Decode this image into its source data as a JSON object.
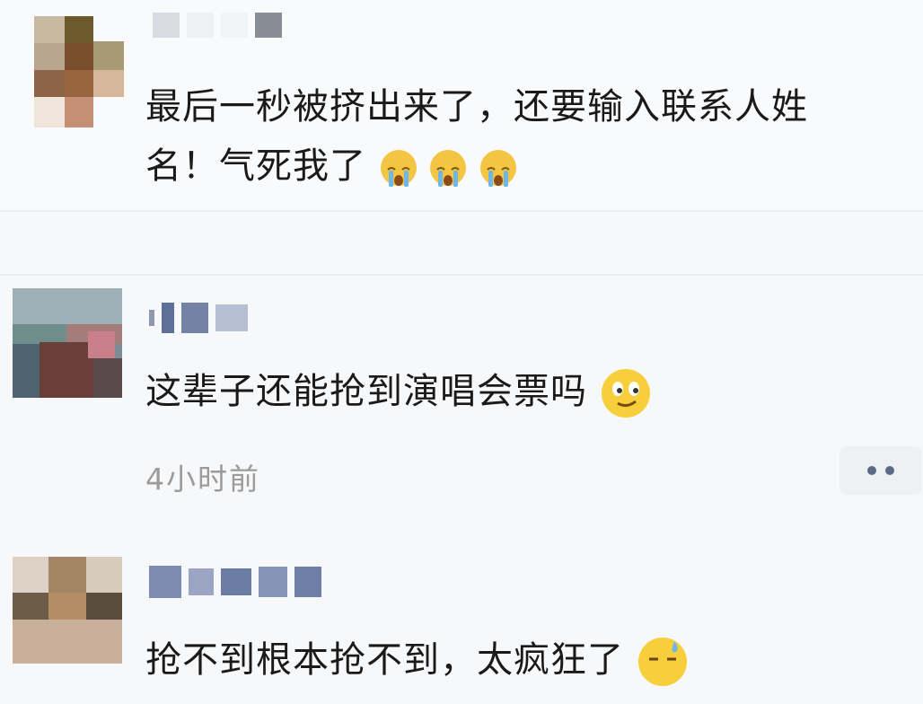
{
  "comments": [
    {
      "text_line1": "最后一秒被挤出来了，还要输入联系人姓",
      "text_line2": "名！气死我了",
      "emoji": "crying-face-icon"
    },
    {
      "text": "这辈子还能抢到演唱会票吗",
      "emoji": "smirk-face-icon",
      "time": "4小时前"
    },
    {
      "text": "抢不到根本抢不到，太疯狂了",
      "emoji": "sweat-smile-icon"
    }
  ],
  "colors": {
    "background": "#f7f8fa",
    "text": "#1a1a1a",
    "time": "#9b9b9b",
    "more_dots": "#5c6b85",
    "blurred_name": "#9aa3b8"
  }
}
